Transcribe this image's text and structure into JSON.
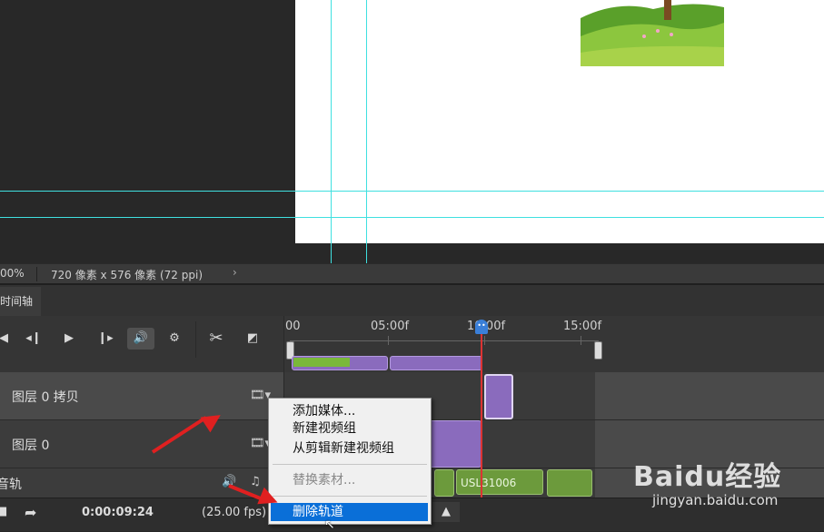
{
  "statusbar": {
    "zoom": "00%",
    "doc_info": "720 像素 x 576 像素 (72 ppi)",
    "more_icon": "chevron-right-icon"
  },
  "panel": {
    "tab_label": "时间轴"
  },
  "controls": {
    "icons": [
      "go-to-first-frame-icon",
      "previous-frame-icon",
      "play-icon",
      "next-frame-icon",
      "audio-icon",
      "gear-icon",
      "scissors-icon",
      "transition-icon"
    ]
  },
  "ruler": {
    "ticks": [
      "00",
      "05:00f",
      "10:00f",
      "15:00f"
    ]
  },
  "tracks": {
    "layer_copy_name": "图层 0 拷贝",
    "layer_name": "图层 0",
    "audio_name": "音轨",
    "audio_clip_label": "USL31006"
  },
  "bottombar": {
    "timecode": "0:00:09:24",
    "fps": "(25.00 fps)"
  },
  "context_menu": {
    "items": {
      "add_media": "添加媒体...",
      "new_video_group": "新建视频组",
      "new_video_group_from_clips": "从剪辑新建视频组",
      "replace_footage": "替换素材...",
      "delete_track": "删除轨道"
    }
  },
  "watermark": {
    "logo": "Baidu经验",
    "url": "jingyan.baidu.com"
  },
  "colors": {
    "guide": "#3fe0e0",
    "video_clip": "#8a6bbd",
    "audio_clip": "#6c9a3c",
    "playhead": "#dd3333",
    "menu_highlight": "#0a6fd8",
    "arrow": "#e02020"
  }
}
